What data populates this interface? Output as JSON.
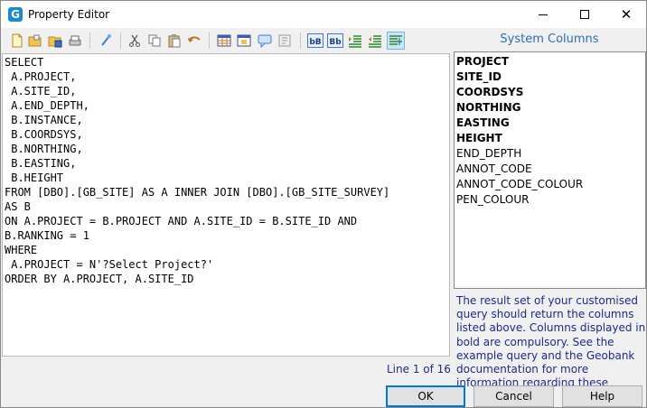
{
  "window": {
    "title": "Property Editor",
    "app_icon_letter": "G"
  },
  "toolbar": {
    "buttons": [
      {
        "icon": "new-page-icon"
      },
      {
        "icon": "open-folder-icon"
      },
      {
        "icon": "save-icon"
      },
      {
        "icon": "print-icon"
      },
      {
        "icon": "find-icon"
      },
      {
        "icon": "cut-icon"
      },
      {
        "icon": "copy-icon"
      },
      {
        "icon": "paste-icon"
      },
      {
        "icon": "undo-icon"
      },
      {
        "icon": "table-icon"
      },
      {
        "icon": "table-edit-icon"
      },
      {
        "icon": "comment-icon"
      },
      {
        "icon": "format-icon"
      },
      {
        "icon": "lowercase-icon",
        "text": "bB"
      },
      {
        "icon": "uppercase-icon",
        "text": "Bb"
      },
      {
        "icon": "indent-icon"
      },
      {
        "icon": "outdent-icon"
      },
      {
        "icon": "align-icon",
        "active": true
      }
    ]
  },
  "editor": {
    "text": "SELECT\n A.PROJECT,\n A.SITE_ID,\n A.END_DEPTH,\n B.INSTANCE,\n B.COORDSYS,\n B.NORTHING,\n B.EASTING,\n B.HEIGHT\nFROM [DBO].[GB_SITE] AS A INNER JOIN [DBO].[GB_SITE_SURVEY]\nAS B\nON A.PROJECT = B.PROJECT AND A.SITE_ID = B.SITE_ID AND\nB.RANKING = 1\nWHERE\n A.PROJECT = N'?Select Project?'\nORDER BY A.PROJECT, A.SITE_ID",
    "line_status": "Line 1 of 16"
  },
  "system_columns": {
    "header": "System Columns",
    "columns": [
      {
        "name": "PROJECT",
        "bold": true
      },
      {
        "name": "SITE_ID",
        "bold": true
      },
      {
        "name": "COORDSYS",
        "bold": true
      },
      {
        "name": "NORTHING",
        "bold": true
      },
      {
        "name": "EASTING",
        "bold": true
      },
      {
        "name": "HEIGHT",
        "bold": true
      },
      {
        "name": "END_DEPTH",
        "bold": false
      },
      {
        "name": "ANNOT_CODE",
        "bold": false
      },
      {
        "name": "ANNOT_CODE_COLOUR",
        "bold": false
      },
      {
        "name": "PEN_COLOUR",
        "bold": false
      }
    ],
    "help_text": "The result set of your customised query should return the columns listed above. Columns displayed in bold are compulsory. See the example query and the Geobank documentation for more information regarding these"
  },
  "buttons": {
    "ok": "OK",
    "cancel": "Cancel",
    "help": "Help"
  },
  "colors": {
    "accent_blue": "#2b6fb3",
    "help_text": "#1e2a8a",
    "ok_border": "#0078d7"
  }
}
